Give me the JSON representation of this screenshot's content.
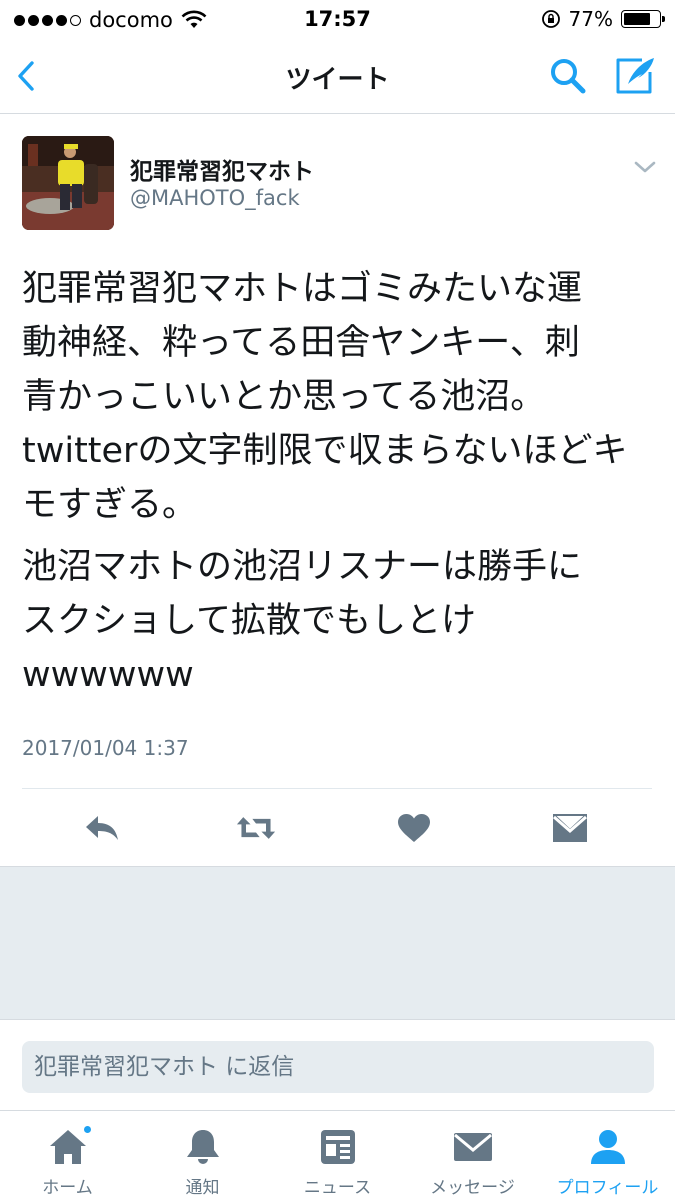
{
  "status_bar": {
    "carrier": "docomo",
    "time": "17:57",
    "battery": "77%",
    "battery_level": 0.77
  },
  "nav": {
    "title": "ツイート"
  },
  "tweet": {
    "display_name": "犯罪常習犯マホト",
    "handle": "@MAHOTO_fack",
    "paragraph_1_lines": [
      "犯罪常習犯マホトはゴミみたいな運",
      "動神経、粋ってる田舎ヤンキー、刺",
      "青かっこいいとか思ってる池沼。",
      "twitterの文字制限で収まらないほどキ",
      "モすぎる。"
    ],
    "paragraph_2_lines": [
      "池沼マホトの池沼リスナーは勝手に",
      "スクショして拡散でもしとけ",
      "wwwwww"
    ],
    "timestamp": "2017/01/04 1:37"
  },
  "reply": {
    "placeholder": "犯罪常習犯マホト に返信"
  },
  "tabs": [
    {
      "label": "ホーム",
      "icon": "home-icon",
      "active": false,
      "badge": true
    },
    {
      "label": "通知",
      "icon": "bell-icon",
      "active": false,
      "badge": false
    },
    {
      "label": "ニュース",
      "icon": "news-icon",
      "active": false,
      "badge": false
    },
    {
      "label": "メッセージ",
      "icon": "mail-icon",
      "active": false,
      "badge": false
    },
    {
      "label": "プロフィール",
      "icon": "person-icon",
      "active": true,
      "badge": false
    }
  ],
  "colors": {
    "accent": "#1da1f2",
    "secondary_text": "#657786",
    "icon_gray": "#657786",
    "background_gray": "#e6ecf0"
  }
}
